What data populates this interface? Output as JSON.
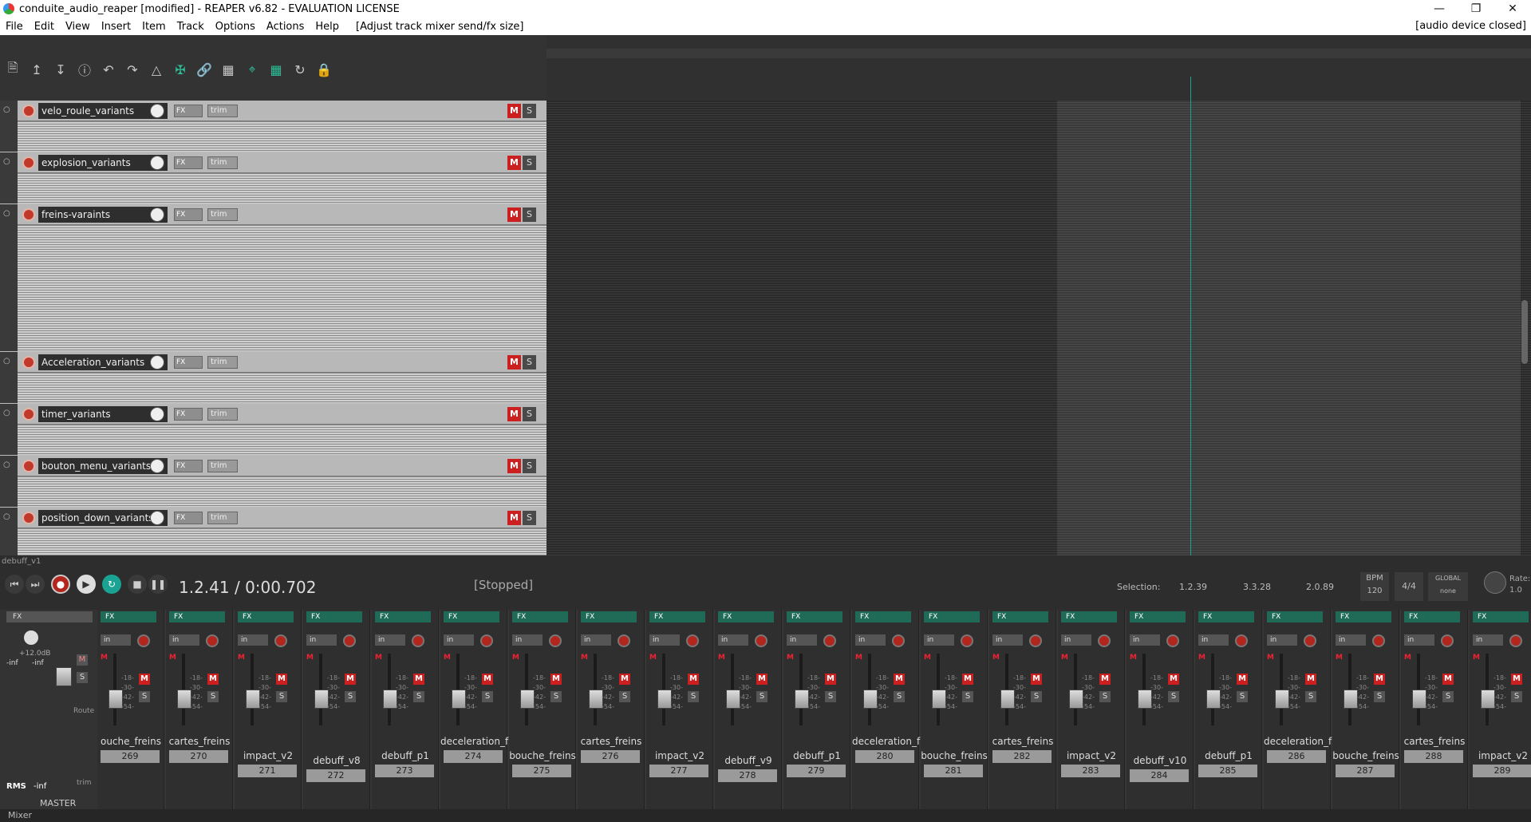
{
  "title": "conduite_audio_reaper [modified] - REAPER v6.82 - EVALUATION LICENSE",
  "menu": [
    "File",
    "Edit",
    "View",
    "Insert",
    "Item",
    "Track",
    "Options",
    "Actions",
    "Help"
  ],
  "action_hint": "[Adjust track mixer send/fx size]",
  "device_status": "[audio device closed]",
  "tracks": [
    {
      "name": "velo_roule_variants"
    },
    {
      "name": "explosion_variants"
    },
    {
      "name": "freins-varaints"
    },
    {
      "name": "Acceleration_variants"
    },
    {
      "name": "timer_variants"
    },
    {
      "name": "bouton_menu_variants"
    },
    {
      "name": "position_down_variants"
    }
  ],
  "track_labels": {
    "fx": "FX",
    "trim": "trim",
    "mute": "M",
    "solo": "S"
  },
  "transport": {
    "item": "debuff_v1",
    "time": "1.2.41 / 0:00.702",
    "state": "[Stopped]",
    "selection_label": "Selection:",
    "sel_start": "1.2.39",
    "sel_end": "3.3.28",
    "sel_len": "2.0.89",
    "bpm_label": "BPM",
    "bpm": "120",
    "sig": "4/4",
    "global_label": "GLOBAL",
    "global_value": "none",
    "rate_label": "Rate:",
    "rate": "1.0"
  },
  "master": {
    "label": "MASTER",
    "fx": "FX",
    "db": "+12.0dB",
    "inf1": "-inf",
    "inf2": "-inf",
    "rms": "RMS",
    "rms_val": "-inf",
    "route": "Route",
    "trim": "trim"
  },
  "strip_labels": {
    "fx": "FX",
    "in": "in",
    "mute": "M",
    "solo": "S",
    "scale": "-18-\n-30-\n-42-\n-54-"
  },
  "strips": [
    {
      "name": "ouche_freins",
      "num": "269"
    },
    {
      "name": "cartes_freins",
      "num": "270"
    },
    {
      "name": "impact_v2",
      "num": "271"
    },
    {
      "name": "debuff_v8",
      "num": "272"
    },
    {
      "name": "debuff_p1",
      "num": "273"
    },
    {
      "name": "deceleration_f",
      "num": "274"
    },
    {
      "name": "bouche_freins",
      "num": "275"
    },
    {
      "name": "cartes_freins",
      "num": "276"
    },
    {
      "name": "impact_v2",
      "num": "277"
    },
    {
      "name": "debuff_v9",
      "num": "278"
    },
    {
      "name": "debuff_p1",
      "num": "279"
    },
    {
      "name": "deceleration_f",
      "num": "280"
    },
    {
      "name": "bouche_freins",
      "num": "281"
    },
    {
      "name": "cartes_freins",
      "num": "282"
    },
    {
      "name": "impact_v2",
      "num": "283"
    },
    {
      "name": "debuff_v10",
      "num": "284"
    },
    {
      "name": "debuff_p1",
      "num": "285"
    },
    {
      "name": "deceleration_f",
      "num": "286"
    },
    {
      "name": "bouche_freins",
      "num": "287"
    },
    {
      "name": "cartes_freins",
      "num": "288"
    },
    {
      "name": "impact_v2",
      "num": "289"
    }
  ],
  "mixer_tab": "Mixer",
  "colors": {
    "accent": "#2fbf9a",
    "mute": "#cc1f1f",
    "record": "#c0392b",
    "cursor": "#1aa392"
  }
}
